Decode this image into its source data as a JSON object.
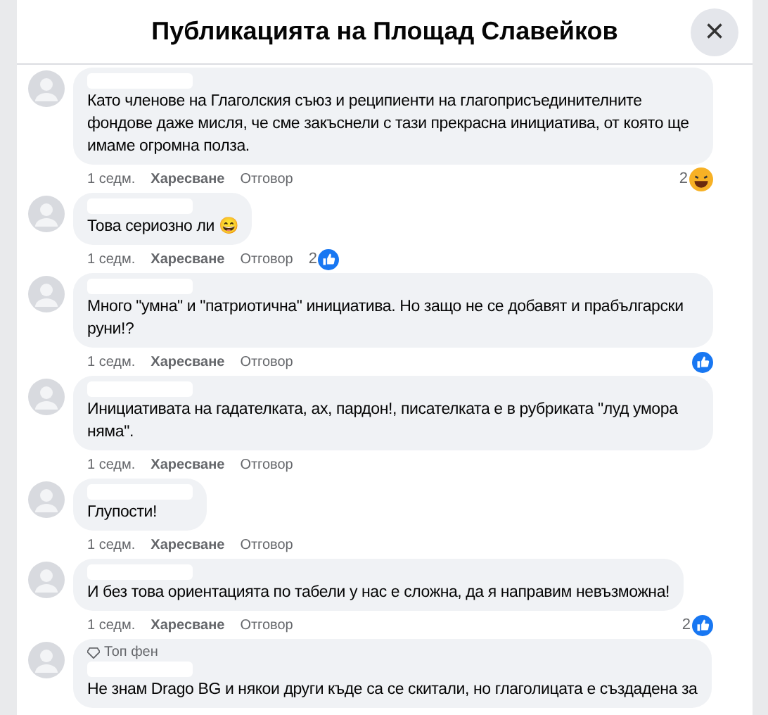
{
  "dialog": {
    "title": "Публикацията на Площад Славейков",
    "close": "×"
  },
  "comments": [
    {
      "text": "Като членове на Глаголския съюз и реципиенти на глагоприсъединителните фондове даже мисля, че сме закъснели с тази прекрасна инициатива, от която ще имаме огромна полза.",
      "time": "1 седм.",
      "like": "Харесване",
      "reply": "Отговор",
      "reaction": {
        "kind": "haha",
        "count": "2",
        "inline": false
      }
    },
    {
      "text": "Това сериозно ли 😄",
      "time": "1 седм.",
      "like": "Харесване",
      "reply": "Отговор",
      "reaction": {
        "kind": "like",
        "count": "2",
        "inline": true
      }
    },
    {
      "text": "Много \"умна\" и \"патриотична\" инициатива. Но защо не се добавят и прабългарски руни!?",
      "time": "1 седм.",
      "like": "Харесване",
      "reply": "Отговор",
      "reaction": {
        "kind": "like",
        "inline": false
      }
    },
    {
      "text": "Инициативата на гадателката, ах, пардон!, писателката е в рубриката \"луд умора няма\".",
      "time": "1 седм.",
      "like": "Харесване",
      "reply": "Отговор"
    },
    {
      "text": "Глупости!",
      "time": "1 седм.",
      "like": "Харесване",
      "reply": "Отговор"
    },
    {
      "text": "И без това ориентацията по табели у нас е сложна, да я направим невъзможна!",
      "time": "1 седм.",
      "like": "Харесване",
      "reply": "Отговор",
      "reaction": {
        "kind": "like",
        "count": "2",
        "inline": false
      }
    },
    {
      "badge": "Топ фен",
      "text": "Не знам Drago BG и някои други къде са се скитали, но глаголицата е създадена за"
    }
  ]
}
